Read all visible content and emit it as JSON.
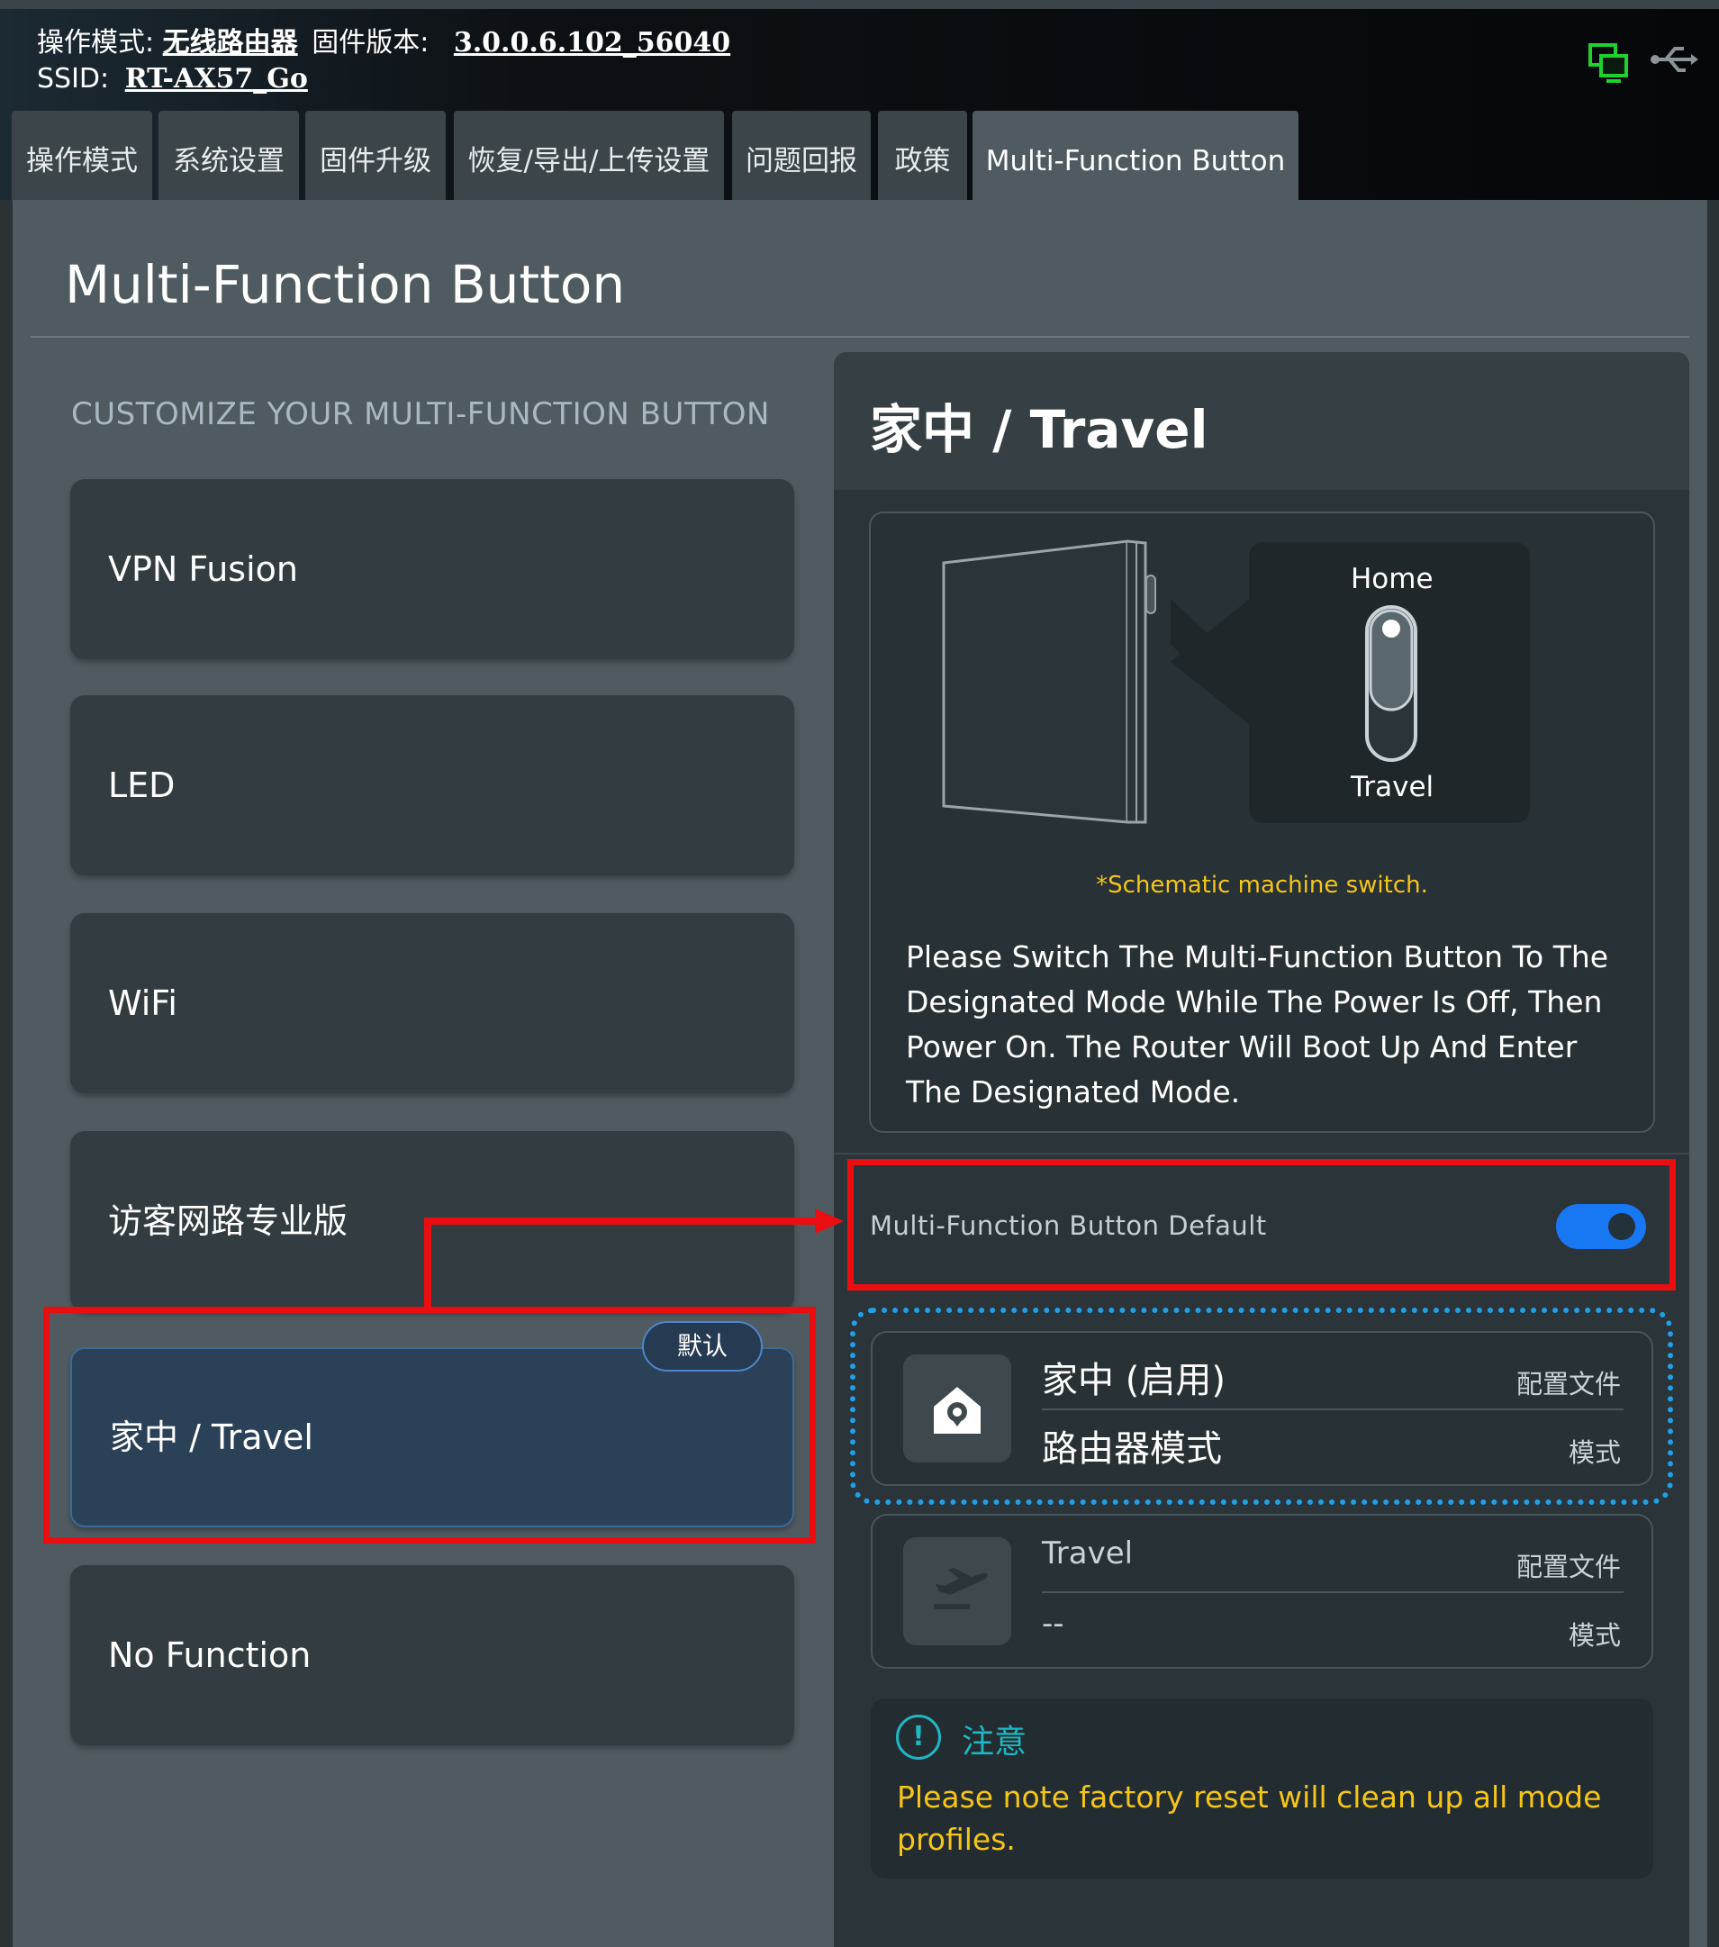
{
  "header": {
    "op_mode_label": "操作模式:",
    "op_mode_value": "无线路由器",
    "fw_label": "固件版本:",
    "fw_value": "3.0.0.6.102_56040",
    "ssid_label": "SSID:",
    "ssid_value": "RT-AX57_Go"
  },
  "tabs": [
    {
      "label": "操作模式"
    },
    {
      "label": "系统设置"
    },
    {
      "label": "固件升级"
    },
    {
      "label": "恢复/导出/上传设置"
    },
    {
      "label": "问题回报"
    },
    {
      "label": "政策"
    },
    {
      "label": "Multi-Function Button",
      "active": true
    }
  ],
  "page_title": "Multi-Function Button",
  "section_label": "CUSTOMIZE YOUR MULTI-FUNCTION BUTTON",
  "options": [
    {
      "label": "VPN Fusion"
    },
    {
      "label": "LED"
    },
    {
      "label": "WiFi"
    },
    {
      "label": "访客网路专业版"
    },
    {
      "label": "家中 / Travel",
      "selected": true
    },
    {
      "label": "No Function"
    }
  ],
  "default_badge": "默认",
  "detail": {
    "title": "家中 / Travel",
    "switch_top": "Home",
    "switch_bottom": "Travel",
    "schematic_note": "*Schematic machine switch.",
    "description": "Please Switch The Multi-Function Button To The Designated Mode While The Power Is Off, Then Power On. The Router Will Boot Up And Enter The Designated Mode.",
    "toggle_label": "Multi-Function Button Default",
    "toggle_on": true
  },
  "profiles": [
    {
      "name": "家中 (启用)",
      "profile_label": "配置文件",
      "mode": "路由器模式",
      "mode_label": "模式",
      "icon": "home-icon"
    },
    {
      "name": "Travel",
      "profile_label": "配置文件",
      "mode": "--",
      "mode_label": "模式",
      "icon": "plane-icon"
    }
  ],
  "notice": {
    "title": "注意",
    "text": "Please note factory reset will clean up all mode profiles."
  },
  "colors": {
    "highlight_red": "#ea0e11",
    "dotted_blue": "#20a0e8",
    "toggle_blue": "#1877f2",
    "warning_yellow": "#f5c518",
    "notice_teal": "#1db8c4"
  }
}
